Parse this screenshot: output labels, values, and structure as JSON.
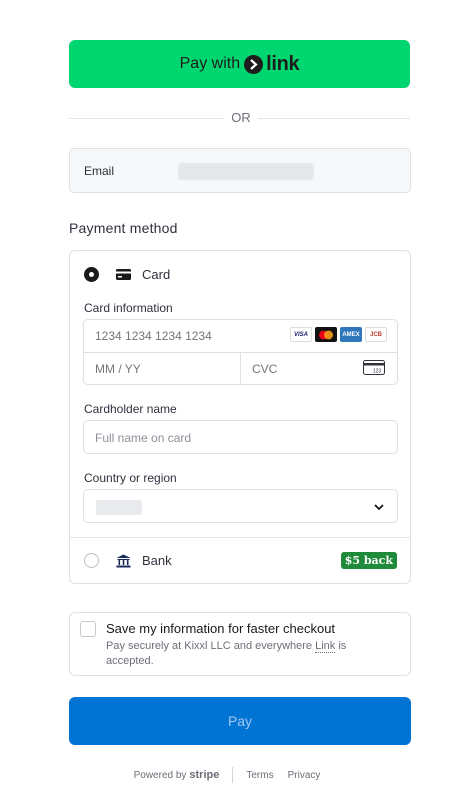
{
  "link_button": {
    "prefix": "Pay with",
    "brand": "link"
  },
  "divider_text": "OR",
  "email": {
    "label": "Email"
  },
  "payment_method": {
    "title": "Payment method",
    "card_option": {
      "label": "Card",
      "selected": true,
      "card_info_label": "Card information",
      "card_number_placeholder": "1234 1234 1234 1234",
      "expiry_placeholder": "MM / YY",
      "cvc_placeholder": "CVC",
      "brands": [
        "VISA",
        "mastercard",
        "AMEX",
        "JCB"
      ],
      "cvc_icon_text": "123"
    },
    "cardholder": {
      "label": "Cardholder name",
      "placeholder": "Full name on card"
    },
    "country": {
      "label": "Country or region"
    },
    "bank_option": {
      "label": "Bank",
      "badge": "$5 back",
      "selected": false
    }
  },
  "save_info": {
    "title": "Save my information for faster checkout",
    "desc_prefix": "Pay securely at Kixxl LLC and everywhere ",
    "desc_link": "Link",
    "desc_suffix": " is accepted.",
    "checked": false
  },
  "pay_button": {
    "label": "Pay"
  },
  "footer": {
    "powered_by": "Powered by",
    "brand": "stripe",
    "terms": "Terms",
    "privacy": "Privacy"
  },
  "colors": {
    "link_green": "#00d66f",
    "pay_blue": "#0074d4",
    "badge_green": "#1f8a3a"
  }
}
